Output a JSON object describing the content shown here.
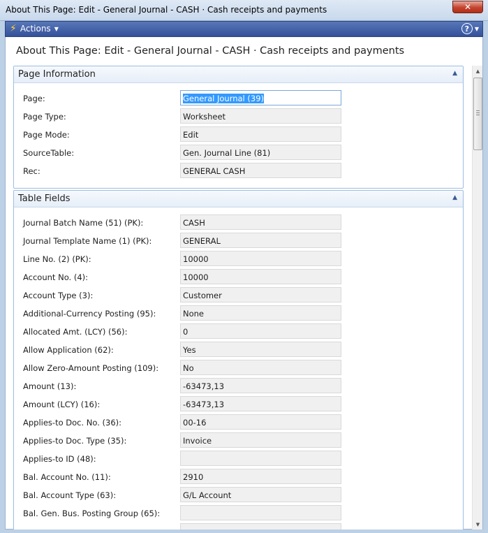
{
  "window": {
    "title": "About This Page: Edit - General Journal - CASH · Cash receipts and payments",
    "close_label": "✕"
  },
  "actionbar": {
    "actions_label": "Actions",
    "help_label": "?"
  },
  "page": {
    "heading": "About This Page: Edit - General Journal - CASH · Cash receipts and payments"
  },
  "page_information": {
    "title": "Page Information",
    "fields": [
      {
        "label": "Page:",
        "value": "General Journal (39)"
      },
      {
        "label": "Page Type:",
        "value": "Worksheet"
      },
      {
        "label": "Page Mode:",
        "value": "Edit"
      },
      {
        "label": "SourceTable:",
        "value": "Gen. Journal Line (81)"
      },
      {
        "label": "Rec:",
        "value": "GENERAL CASH"
      }
    ]
  },
  "table_fields": {
    "title": "Table Fields",
    "fields": [
      {
        "label": "Journal Batch Name (51) (PK):",
        "value": "CASH"
      },
      {
        "label": "Journal Template Name (1) (PK):",
        "value": "GENERAL"
      },
      {
        "label": "Line No. (2) (PK):",
        "value": "10000"
      },
      {
        "label": "Account No. (4):",
        "value": "10000"
      },
      {
        "label": "Account Type (3):",
        "value": "Customer"
      },
      {
        "label": "Additional-Currency Posting (95):",
        "value": "None"
      },
      {
        "label": "Allocated Amt. (LCY) (56):",
        "value": "0"
      },
      {
        "label": "Allow Application (62):",
        "value": "Yes"
      },
      {
        "label": "Allow Zero-Amount Posting (109):",
        "value": "No"
      },
      {
        "label": "Amount (13):",
        "value": "-63473,13"
      },
      {
        "label": "Amount (LCY) (16):",
        "value": "-63473,13"
      },
      {
        "label": "Applies-to Doc. No. (36):",
        "value": "00-16"
      },
      {
        "label": "Applies-to Doc. Type (35):",
        "value": "Invoice"
      },
      {
        "label": "Applies-to ID (48):",
        "value": ""
      },
      {
        "label": "Bal. Account No. (11):",
        "value": "2910"
      },
      {
        "label": "Bal. Account Type (63):",
        "value": "G/L Account"
      },
      {
        "label": "Bal. Gen. Bus. Posting Group (65):",
        "value": ""
      },
      {
        "label": "",
        "value": ""
      }
    ]
  }
}
